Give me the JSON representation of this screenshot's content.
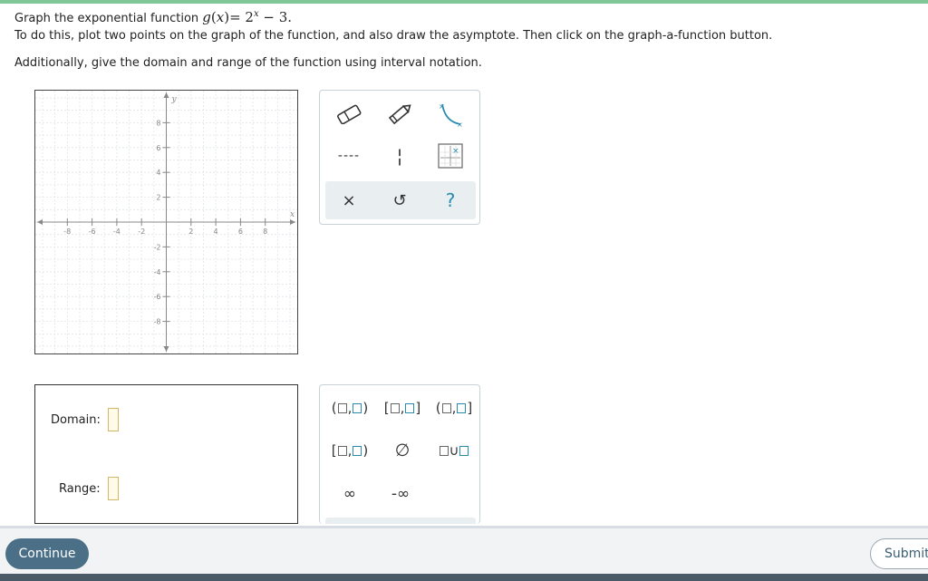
{
  "question": {
    "line1_prefix": "Graph the exponential function ",
    "func_name": "g",
    "func_var": "x",
    "func_base": "= 2",
    "func_exp": "x",
    "func_tail": " − 3.",
    "line2": "To do this, plot two points on the graph of the function, and also draw the asymptote. Then click on the graph-a-function button.",
    "line3": "Additionally, give the domain and range of the function using interval notation."
  },
  "graph": {
    "x_axis_label": "x",
    "y_axis_label": "y",
    "x_range": [
      -10,
      10
    ],
    "y_range": [
      -10,
      10
    ],
    "x_ticks": [
      "-8",
      "-6",
      "-4",
      "-2",
      "2",
      "4",
      "6",
      "8"
    ],
    "y_ticks": [
      "8",
      "6",
      "4",
      "2",
      "-2",
      "-4",
      "-6",
      "-8"
    ]
  },
  "tools": {
    "eraser": "eraser-icon",
    "pencil": "pencil-icon",
    "curve": "curve-tool-icon",
    "dashed_line": "----",
    "vertical_dashed_line": "¦",
    "graph_function": "graph-function-icon",
    "clear": "×",
    "undo": "↺",
    "help": "?"
  },
  "answers": {
    "domain_label": "Domain:",
    "range_label": "Range:"
  },
  "keypad": {
    "open_open": [
      "(",
      ",",
      ")"
    ],
    "closed_closed": [
      "[",
      ",",
      "]"
    ],
    "open_closed": [
      "(",
      ",",
      "]"
    ],
    "closed_open": [
      "[",
      ",",
      ")"
    ],
    "empty_set": "∅",
    "union": "∪",
    "infinity": "∞",
    "neg_infinity": "-∞"
  },
  "footer": {
    "continue_label": "Continue",
    "submit_label": "Submit"
  },
  "colors": {
    "accent": "#7fc797",
    "tool_blue": "#2a8ab0",
    "continue_bg": "#4a6f86"
  }
}
